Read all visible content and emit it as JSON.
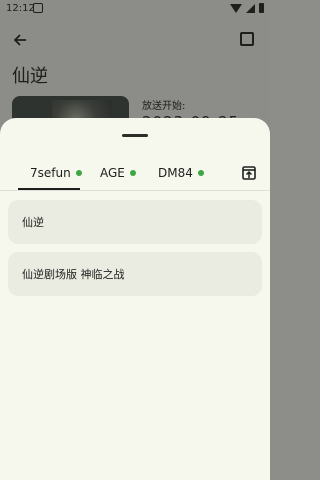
{
  "status_bar": {
    "time": "12:12"
  },
  "background_page": {
    "title": "仙逆",
    "broadcast_label": "放送开始:",
    "date": "2023-09-25"
  },
  "sheet": {
    "tabs": [
      {
        "label": "7sefun",
        "active": true,
        "status_color": "#3da542"
      },
      {
        "label": "AGE",
        "active": false,
        "status_color": "#3da542"
      },
      {
        "label": "DM84",
        "active": false,
        "status_color": "#3da542"
      }
    ],
    "results": [
      {
        "title": "仙逆"
      },
      {
        "title": "仙逆剧场版 神临之战"
      }
    ]
  }
}
